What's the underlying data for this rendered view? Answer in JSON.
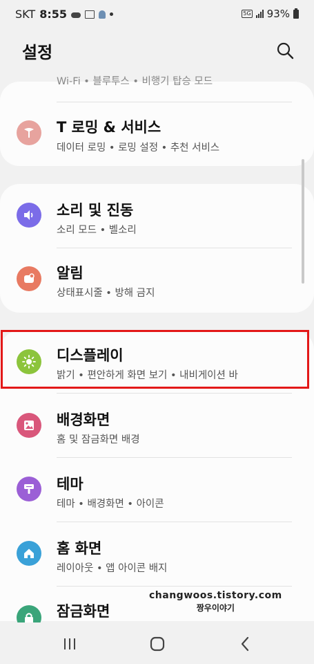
{
  "status_bar": {
    "carrier": "SKT",
    "time": "8:55",
    "network": "5G",
    "battery": "93%"
  },
  "header": {
    "title": "설정"
  },
  "items": [
    {
      "title": "",
      "subtitle": "Wi-Fi • 블루투스 • 비행기 탑승 모드",
      "icon": "wifi-icon",
      "color": "#4a86e8"
    },
    {
      "title": "T 로밍 & 서비스",
      "subtitle": "데이터 로밍 • 로밍 설정 • 추천 서비스",
      "icon": "roaming-icon",
      "color": "#e7a39e"
    },
    {
      "title": "소리 및 진동",
      "subtitle": "소리 모드 • 벨소리",
      "icon": "sound-icon",
      "color": "#7b6ce8"
    },
    {
      "title": "알림",
      "subtitle": "상태표시줄 • 방해 금지",
      "icon": "notification-icon",
      "color": "#e87a62"
    },
    {
      "title": "디스플레이",
      "subtitle": "밝기 • 편안하게 화면 보기 • 내비게이션 바",
      "icon": "display-icon",
      "color": "#8cc43c"
    },
    {
      "title": "배경화면",
      "subtitle": "홈 및 잠금화면 배경",
      "icon": "wallpaper-icon",
      "color": "#d9577b"
    },
    {
      "title": "테마",
      "subtitle": "테마 • 배경화면 • 아이콘",
      "icon": "theme-icon",
      "color": "#9b5fd6"
    },
    {
      "title": "홈 화면",
      "subtitle": "레이아웃 • 앱 아이콘 배지",
      "icon": "home-icon",
      "color": "#3aa1d8"
    },
    {
      "title": "잠금화면",
      "subtitle": "",
      "icon": "lock-icon",
      "color": "#3aa57a"
    }
  ],
  "watermark": {
    "line1": "changwoos.tistory.com",
    "line2": "짱우이야기"
  },
  "colors": {
    "highlight": "#e31818",
    "background": "#f1f1f1",
    "card": "#fcfcfc"
  }
}
